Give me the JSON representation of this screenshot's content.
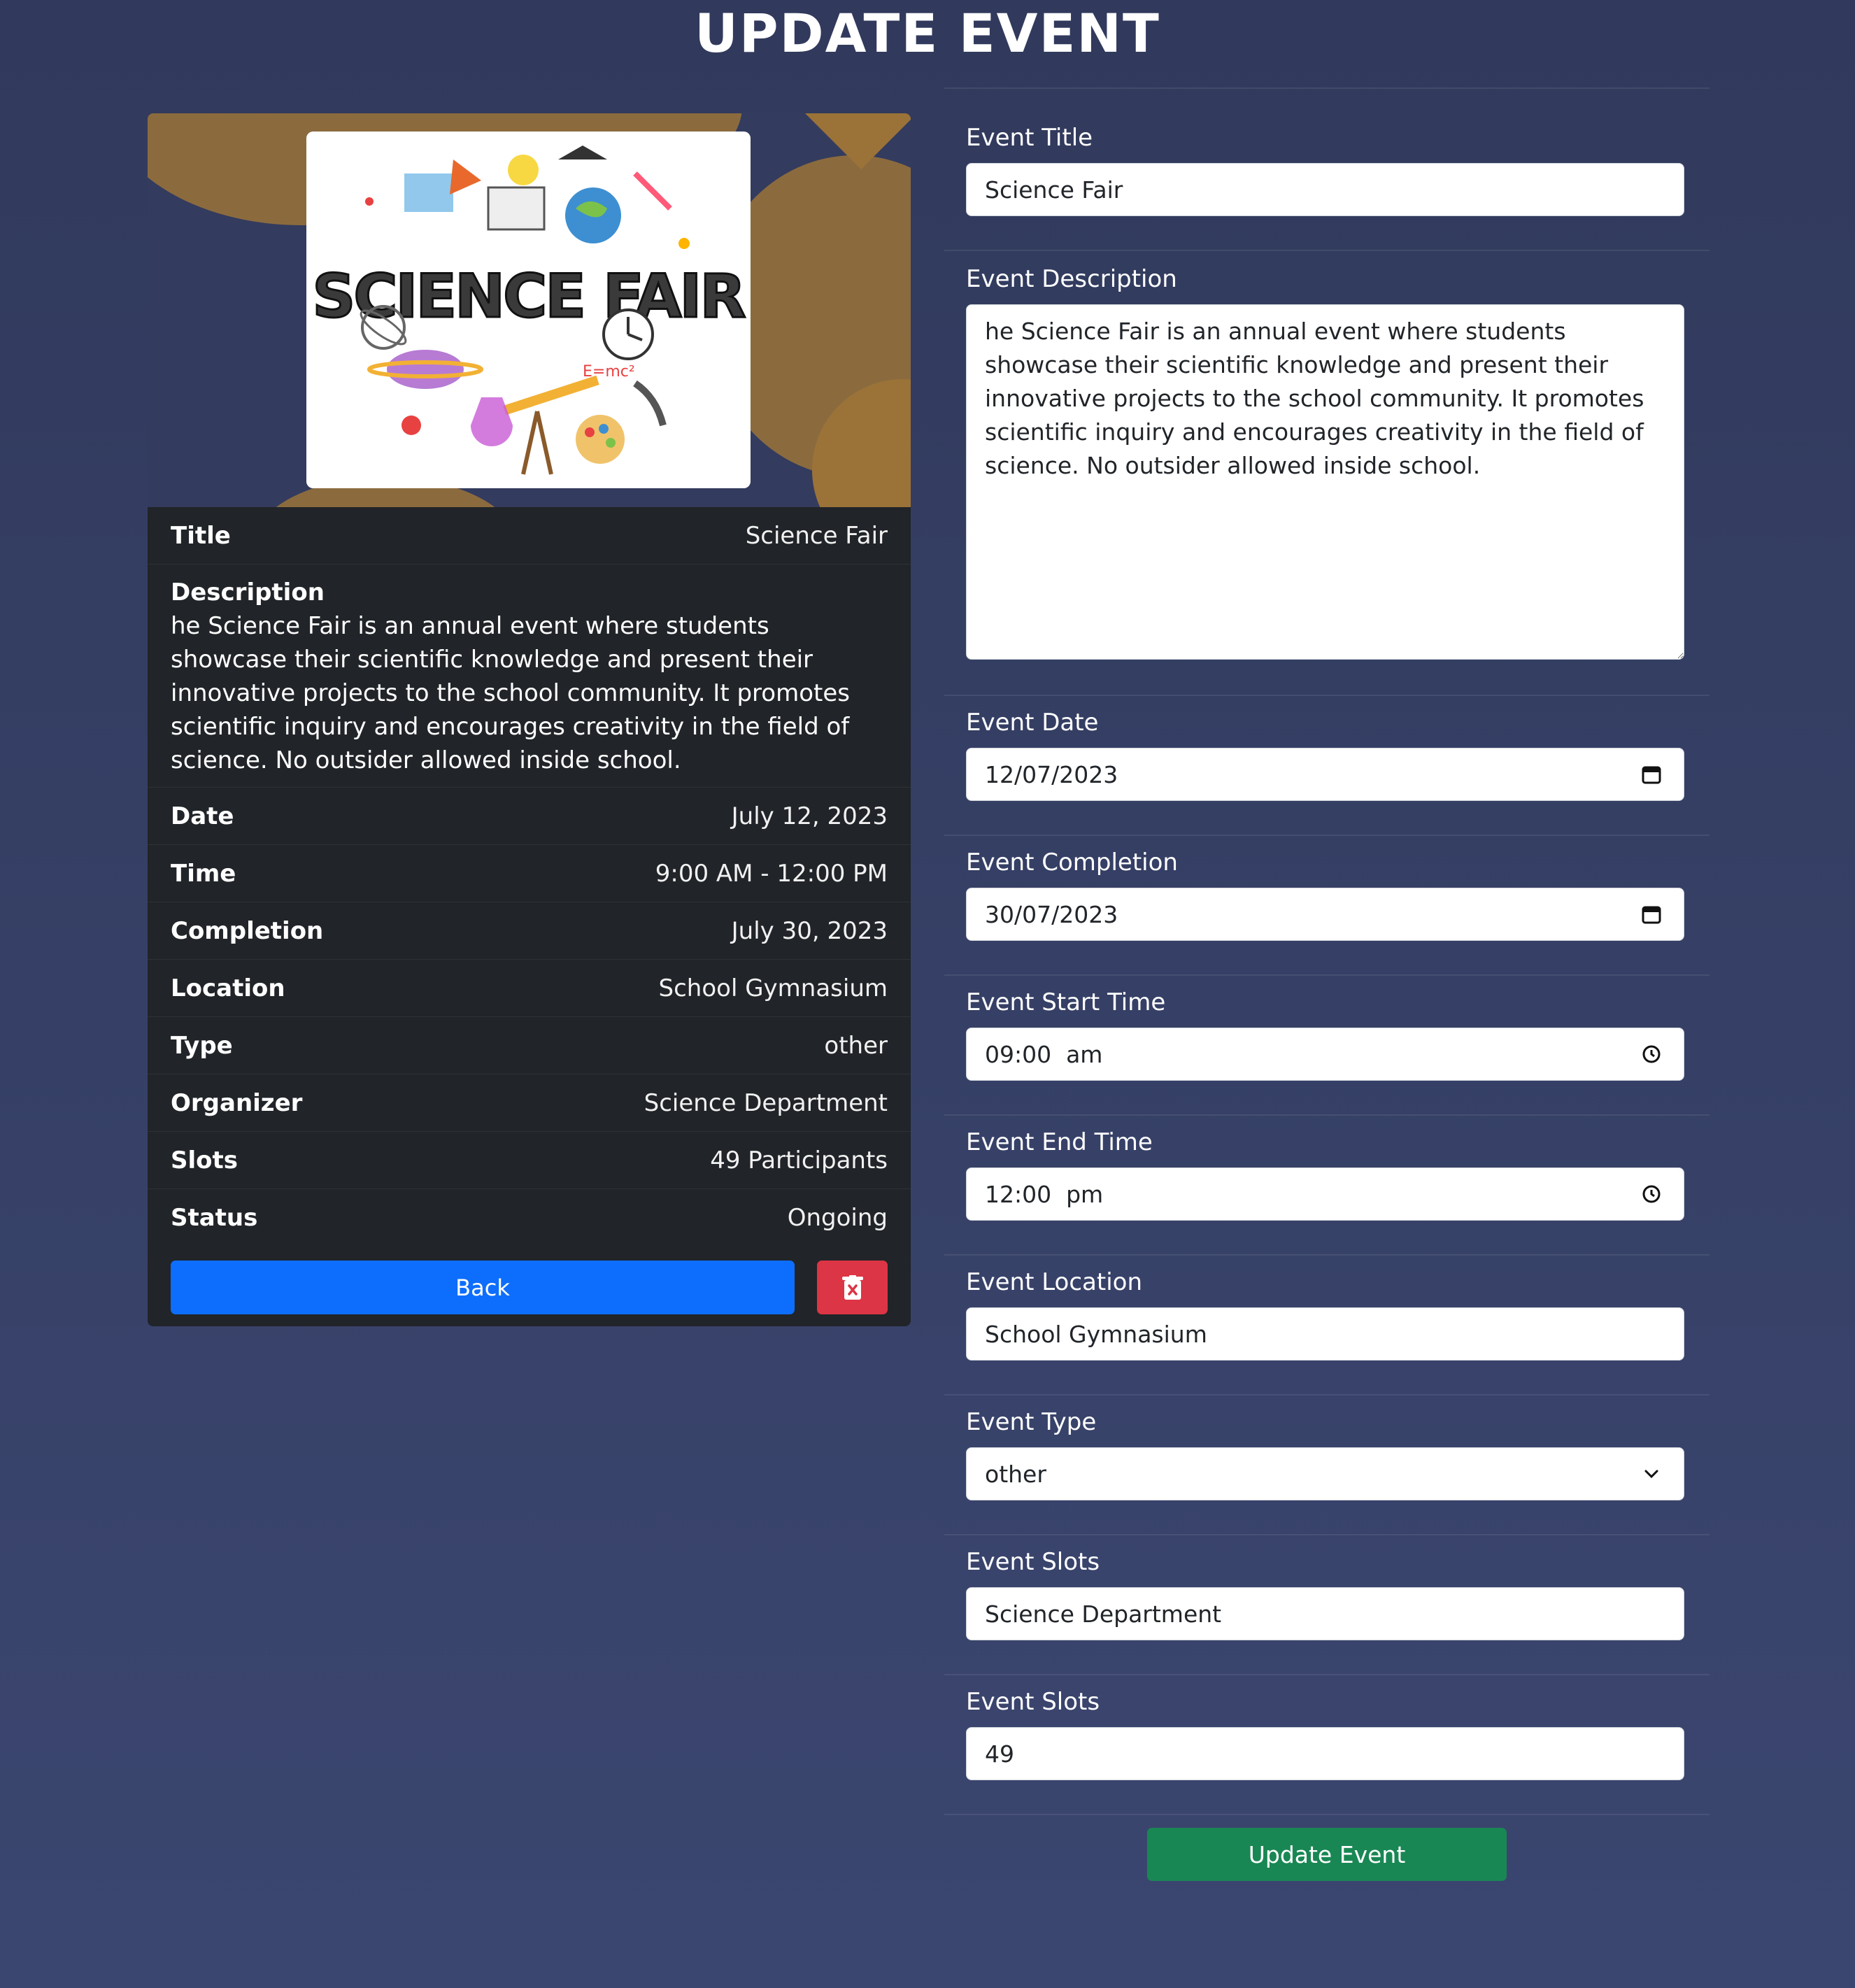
{
  "page": {
    "title": "UPDATE EVENT"
  },
  "card": {
    "image_alt": "SCIENCE FAIR",
    "image_text": "SCIENCE FAIR",
    "image_formula": "E=mc²",
    "rows": {
      "title": {
        "label": "Title",
        "value": "Science Fair"
      },
      "description": {
        "label": "Description",
        "value": "he Science Fair is an annual event where students showcase their scientific knowledge and present their innovative projects to the school community. It promotes scientific inquiry and encourages creativity in the field of science. No outsider allowed inside school."
      },
      "date": {
        "label": "Date",
        "value": "July 12, 2023"
      },
      "time": {
        "label": "Time",
        "value": "9:00 AM - 12:00 PM"
      },
      "completion": {
        "label": "Completion",
        "value": "July 30, 2023"
      },
      "location": {
        "label": "Location",
        "value": "School Gymnasium"
      },
      "type": {
        "label": "Type",
        "value": "other"
      },
      "organizer": {
        "label": "Organizer",
        "value": "Science Department"
      },
      "slots": {
        "label": "Slots",
        "value": "49 Participants"
      },
      "status": {
        "label": "Status",
        "value": "Ongoing"
      }
    },
    "back_label": "Back",
    "delete_icon": "trash-x-icon"
  },
  "form": {
    "event_title": {
      "label": "Event Title",
      "value": "Science Fair"
    },
    "event_description": {
      "label": "Event Description",
      "value": "he Science Fair is an annual event where students showcase their scientific knowledge and present their innovative projects to the school community. It promotes scientific inquiry and encourages creativity in the field of science. No outsider allowed inside school."
    },
    "event_date": {
      "label": "Event Date",
      "value": "12/07/2023",
      "icon": "calendar-icon"
    },
    "event_completion": {
      "label": "Event Completion",
      "value": "30/07/2023",
      "icon": "calendar-icon"
    },
    "event_start_time": {
      "label": "Event Start Time",
      "value": "09:00  am",
      "icon": "clock-icon"
    },
    "event_end_time": {
      "label": "Event End Time",
      "value": "12:00  pm",
      "icon": "clock-icon"
    },
    "event_location": {
      "label": "Event Location",
      "value": "School Gymnasium"
    },
    "event_type": {
      "label": "Event Type",
      "value": "other",
      "icon": "chevron-down-icon"
    },
    "event_organizer": {
      "label": "Event Slots",
      "value": "Science Department"
    },
    "event_slots": {
      "label": "Event Slots",
      "value": "49"
    },
    "submit_label": "Update Event"
  },
  "colors": {
    "background": "#313a5c",
    "card": "#212428",
    "primary": "#0d6efd",
    "danger": "#dc3545",
    "success": "#198754",
    "banner_accent": "#8b6b3e"
  }
}
